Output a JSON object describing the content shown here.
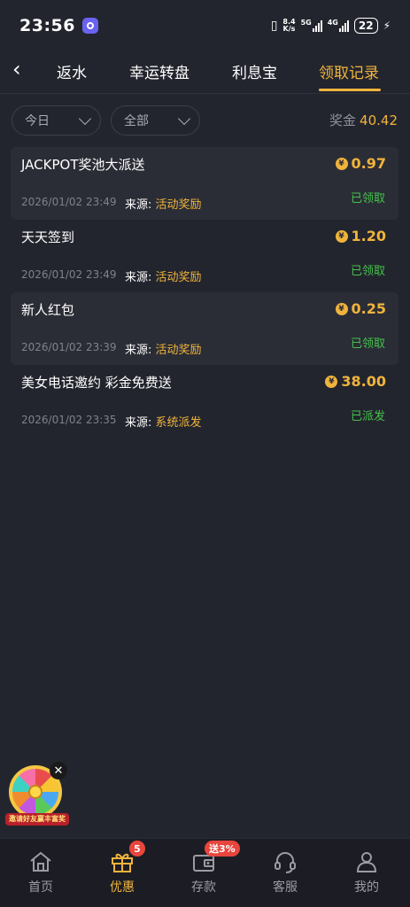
{
  "status_bar": {
    "time": "23:56",
    "network_speed_value": "8.4",
    "network_speed_unit": "K/s",
    "net1_label": "5G",
    "net2_label": "4G",
    "battery": "22"
  },
  "header": {
    "tabs": [
      {
        "label": "返水"
      },
      {
        "label": "幸运转盘"
      },
      {
        "label": "利息宝"
      },
      {
        "label": "领取记录"
      }
    ],
    "active_tab": "领取记录"
  },
  "filters": {
    "date": "今日",
    "type": "全部"
  },
  "summary": {
    "bonus_label": "奖金",
    "bonus_value": "40.42"
  },
  "source_label": "来源:",
  "records": [
    {
      "title": "JACKPOT奖池大派送",
      "amount": "0.97",
      "time": "2026/01/02 23:49",
      "source": "活动奖励",
      "status": "已领取"
    },
    {
      "title": "天天签到",
      "amount": "1.20",
      "time": "2026/01/02 23:49",
      "source": "活动奖励",
      "status": "已领取"
    },
    {
      "title": "新人红包",
      "amount": "0.25",
      "time": "2026/01/02 23:39",
      "source": "活动奖励",
      "status": "已领取"
    },
    {
      "title": "美女电话邀约 彩金免费送",
      "amount": "38.00",
      "time": "2026/01/02 23:35",
      "source": "系统派发",
      "status": "已派发"
    }
  ],
  "floating_promo": {
    "banner": "邀请好友赢丰富奖"
  },
  "bottom_nav": {
    "items": [
      {
        "label": "首页",
        "icon": "home-icon"
      },
      {
        "label": "优惠",
        "icon": "gift-icon",
        "badge": "5"
      },
      {
        "label": "存款",
        "icon": "wallet-icon",
        "badge": "送3%"
      },
      {
        "label": "客服",
        "icon": "headset-icon"
      },
      {
        "label": "我的",
        "icon": "user-icon"
      }
    ],
    "active": "优惠"
  },
  "colors": {
    "background": "#23252e",
    "accent": "#f0b43c",
    "success": "#43c24b",
    "badge": "#e8453c"
  }
}
